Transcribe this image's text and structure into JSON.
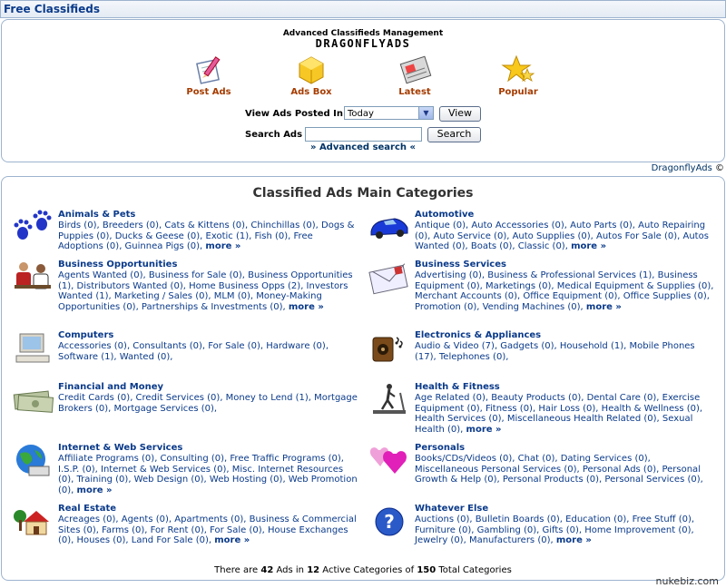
{
  "header": {
    "title": "Free Classifieds"
  },
  "brand": {
    "tagline": "Advanced Classifieds Management",
    "logo_text": "DRAGONFLYADS"
  },
  "nav": [
    {
      "label": "Post Ads",
      "icon": "pencil-paper-icon"
    },
    {
      "label": "Ads Box",
      "icon": "yellow-box-icon"
    },
    {
      "label": "Latest",
      "icon": "newspaper-icon"
    },
    {
      "label": "Popular",
      "icon": "star-icon"
    }
  ],
  "view_form": {
    "label": "View Ads Posted In",
    "selected": "Today",
    "button": "View"
  },
  "search_form": {
    "label": "Search Ads",
    "value": "",
    "button": "Search"
  },
  "advanced_search": "» Advanced search «",
  "credit": {
    "text": "DragonflyAds",
    "symbol": "©"
  },
  "main": {
    "title": "Classified Ads Main Categories",
    "categories": [
      {
        "name": "Animals & Pets",
        "subs": "Birds (0), Breeders (0), Cats & Kittens (0), Chinchillas (0), Dogs & Puppies (0), Ducks & Geese (0), Exotic (1), Fish (0), Free Adoptions (0), Guinnea Pigs (0),",
        "more": "more »"
      },
      {
        "name": "Automotive",
        "subs": "Antique (0), Auto Accessories (0), Auto Parts (0), Auto Repairing (0), Auto Service (0), Auto Supplies (0), Autos For Sale (0), Autos Wanted (0), Boats (0), Classic (0),",
        "more": "more »"
      },
      {
        "name": "Business Opportunities",
        "subs": "Agents Wanted (0), Business for Sale (0), Business Opportunities (1), Distributors Wanted (0), Home Business Opps (2), Investors Wanted (1), Marketing / Sales (0), MLM (0), Money-Making Opportunities (0), Partnerships & Investments (0),",
        "more": "more »"
      },
      {
        "name": "Business Services",
        "subs": "Advertising (0), Business & Professional Services (1), Business Equipment (0), Marketings (0), Medical Equipment & Supplies (0), Merchant Accounts (0), Office Equipment (0), Office Supplies (0), Promotion (0), Vending Machines (0),",
        "more": "more »"
      },
      {
        "name": "Computers",
        "subs": "Accessories (0), Consultants (0), For Sale (0), Hardware (0), Software (1), Wanted (0),",
        "more": ""
      },
      {
        "name": "Electronics & Appliances",
        "subs": "Audio & Video (7), Gadgets (0), Household (1), Mobile Phones (17), Telephones (0),",
        "more": ""
      },
      {
        "name": "Financial and Money",
        "subs": "Credit Cards (0), Credit Services (0), Money to Lend (1), Mortgage Brokers (0), Mortgage Services (0),",
        "more": ""
      },
      {
        "name": "Health & Fitness",
        "subs": "Age Related (0), Beauty Products (0), Dental Care (0), Exercise Equipment (0), Fitness (0), Hair Loss (0), Health & Wellness (0), Health Services (0), Miscellaneous Health Related (0), Sexual Health (0),",
        "more": "more »"
      },
      {
        "name": "Internet & Web Services",
        "subs": "Affiliate Programs (0), Consulting (0), Free Traffic Programs (0), I.S.P. (0), Internet & Web Services (0), Misc. Internet Resources (0), Training (0), Web Design (0), Web Hosting (0), Web Promotion (0),",
        "more": "more »"
      },
      {
        "name": "Personals",
        "subs": "Books/CDs/Videos (0), Chat (0), Dating Services (0), Miscellaneous Personal Services (0), Personal Ads (0), Personal Growth & Help (0), Personal Products (0), Personal Services (0),",
        "more": ""
      },
      {
        "name": "Real Estate",
        "subs": "Acreages (0), Agents (0), Apartments (0), Business & Commercial Sites (0), Farms (0), For Rent (0), For Sale (0), House Exchanges (0), Houses (0), Land For Sale (0),",
        "more": "more »"
      },
      {
        "name": "Whatever Else",
        "subs": "Auctions (0), Bulletin Boards (0), Education (0), Free Stuff (0), Furniture (0), Gambling (0), Gifts (0), Home Improvement (0), Jewelry (0), Manufacturers (0),",
        "more": "more »"
      }
    ]
  },
  "summary": {
    "pre": "There are",
    "ads": "42",
    "mid1": "Ads in",
    "active": "12",
    "mid2": "Active Categories of",
    "total": "150",
    "post": "Total Categories"
  },
  "watermark": "nukebiz.com"
}
